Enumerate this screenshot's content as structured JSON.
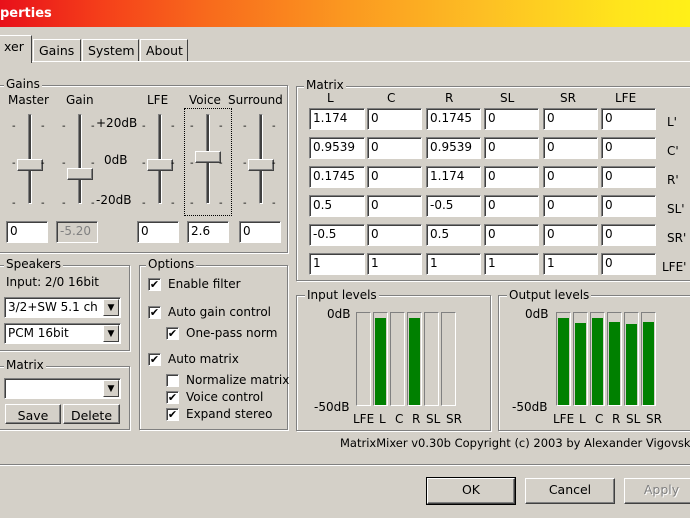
{
  "window": {
    "title": "perties"
  },
  "tabs": [
    "xer",
    "Gains",
    "System",
    "About"
  ],
  "gains": {
    "label": "Gains",
    "channels": [
      {
        "label": "Master",
        "value": "0",
        "level": 0.43
      },
      {
        "label": "Gain",
        "value": "-5.20",
        "level": 0.33
      },
      {
        "label": "LFE",
        "value": "0",
        "level": 0.43
      },
      {
        "label": "Voice",
        "value": "2.6",
        "level": 0.52
      },
      {
        "label": "Surround",
        "value": "0",
        "level": 0.43
      }
    ],
    "scale": {
      "top": "+20dB",
      "mid": "0dB",
      "bottom": "-20dB"
    }
  },
  "matrix": {
    "label": "Matrix",
    "columns": [
      "L",
      "C",
      "R",
      "SL",
      "SR",
      "LFE"
    ],
    "rows": [
      {
        "label": "L'",
        "cells": [
          "1.174",
          "0",
          "0.1745",
          "0",
          "0",
          "0"
        ]
      },
      {
        "label": "C'",
        "cells": [
          "0.9539",
          "0",
          "0.9539",
          "0",
          "0",
          "0"
        ]
      },
      {
        "label": "R'",
        "cells": [
          "0.1745",
          "0",
          "1.174",
          "0",
          "0",
          "0"
        ]
      },
      {
        "label": "SL'",
        "cells": [
          "0.5",
          "0",
          "-0.5",
          "0",
          "0",
          "0"
        ]
      },
      {
        "label": "SR'",
        "cells": [
          "-0.5",
          "0",
          "0.5",
          "0",
          "0",
          "0"
        ]
      },
      {
        "label": "LFE'",
        "cells": [
          "1",
          "1",
          "1",
          "1",
          "1",
          "0"
        ]
      }
    ]
  },
  "speakers": {
    "label": "Speakers",
    "input": "Input: 2/0 16bit",
    "layout": "3/2+SW 5.1 ch",
    "format": "PCM 16bit"
  },
  "matrix_presets": {
    "label": "Matrix",
    "selected": "",
    "save": "Save",
    "delete": "Delete"
  },
  "options": {
    "label": "Options",
    "items": [
      {
        "label": "Enable filter",
        "checked": true
      },
      {
        "label": "Auto gain control",
        "checked": true
      },
      {
        "label": "One-pass norm",
        "checked": true
      },
      {
        "label": "Auto matrix",
        "checked": true
      },
      {
        "label": "Normalize matrix",
        "checked": false
      },
      {
        "label": "Voice control",
        "checked": true
      },
      {
        "label": "Expand stereo",
        "checked": true
      }
    ]
  },
  "input_levels": {
    "label": "Input levels",
    "top": "0dB",
    "bottom": "-50dB",
    "channels": [
      "LFE",
      "L",
      "C",
      "R",
      "SL",
      "SR"
    ],
    "levels": [
      0,
      0.95,
      0,
      0.95,
      0,
      0
    ]
  },
  "output_levels": {
    "label": "Output levels",
    "top": "0dB",
    "bottom": "-50dB",
    "channels": [
      "LFE",
      "L",
      "C",
      "R",
      "SL",
      "SR"
    ],
    "levels": [
      0.95,
      0.89,
      0.95,
      0.9,
      0.88,
      0.9
    ]
  },
  "copyright": "MatrixMixer v0.30b Copyright (c) 2003 by Alexander Vigovsky",
  "buttons": {
    "ok": "OK",
    "cancel": "Cancel",
    "apply": "Apply"
  },
  "check_glyph": "✔",
  "arrow_glyph": "▼"
}
